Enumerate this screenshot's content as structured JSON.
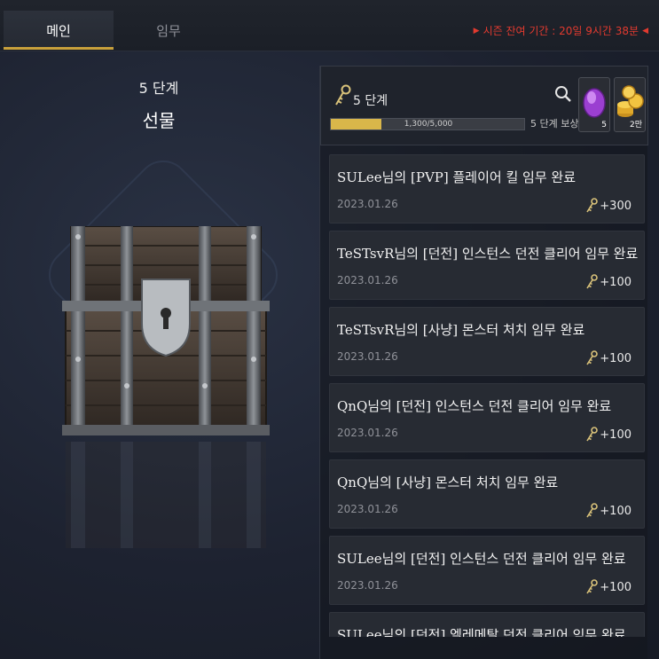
{
  "tabs": [
    {
      "label": "메인",
      "active": true
    },
    {
      "label": "임무",
      "active": false
    }
  ],
  "season": {
    "text": "시즌 잔여 기간 : 20일 9시간 38분",
    "color": "#e23a2f"
  },
  "left_panel": {
    "stage": "5 단계",
    "title": "선물"
  },
  "level": {
    "label": "5 단계",
    "progress_text": "1,300/5,000",
    "progress_fraction": 0.26,
    "reward_label": "5 단계 보상",
    "items": [
      {
        "icon": "purple-gem-icon",
        "count": "5"
      },
      {
        "icon": "gold-coins-icon",
        "count": "2만"
      }
    ]
  },
  "accent_color": "#d9b64a",
  "entries": [
    {
      "message": "SULee님의 [PVP] 플레이어 킬 임무 완료",
      "date": "2023.01.26",
      "points": "+300"
    },
    {
      "message": "TeSTsvR님의 [던전] 인스턴스 던전 클리어 임무 완료",
      "date": "2023.01.26",
      "points": "+100"
    },
    {
      "message": "TeSTsvR님의 [사냥] 몬스터 처치 임무 완료",
      "date": "2023.01.26",
      "points": "+100"
    },
    {
      "message": "QnQ님의 [던전] 인스턴스 던전 클리어 임무 완료",
      "date": "2023.01.26",
      "points": "+100"
    },
    {
      "message": "QnQ님의 [사냥] 몬스터 처치 임무 완료",
      "date": "2023.01.26",
      "points": "+100"
    },
    {
      "message": "SULee님의 [던전] 인스턴스 던전 클리어 임무 완료",
      "date": "2023.01.26",
      "points": "+100"
    },
    {
      "message": "SULee님의 [던전] 엘레메탈 던전 클리어 임무 완료",
      "date": "",
      "points": ""
    }
  ]
}
